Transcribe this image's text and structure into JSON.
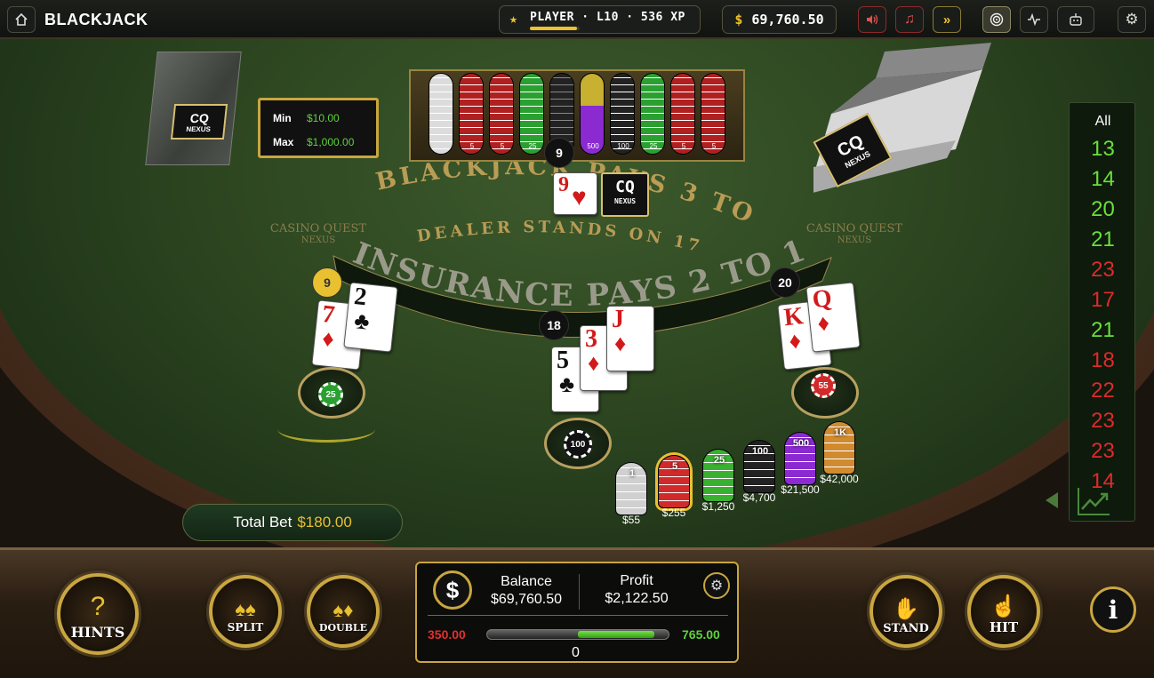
{
  "topbar": {
    "title": "BLACKJACK",
    "player_label": "PLAYER · L10 · 536 XP",
    "xp_progress": 0.95,
    "currency_symbol": "$",
    "balance_display": "69,760.50",
    "icons": [
      "home-icon",
      "volume-icon",
      "music-icon",
      "fast-forward-icon",
      "target-icon",
      "activity-icon",
      "robot-icon",
      "settings-icon"
    ]
  },
  "table": {
    "min_label": "Min",
    "min_value": "$10.00",
    "max_label": "Max",
    "max_value": "$1,000.00",
    "felt_line1": "BLACKJACK PAYS 3 TO 2",
    "felt_line2": "DEALER STANDS ON 17",
    "felt_line3": "INSURANCE PAYS 2 TO 1",
    "brand_logo": "CASINO QUEST",
    "brand_sub": "NEXUS",
    "shoe_logo": "CQ",
    "shoe_logo_sub": "NEXUS",
    "tray_chip_labels": [
      "5",
      "5",
      "25",
      "",
      "500",
      "100",
      "25",
      "5",
      "5"
    ],
    "dealer": {
      "score": "9",
      "cards": [
        {
          "rank": "9",
          "suit": "♥",
          "color": "red"
        }
      ],
      "hole_card_logo": "CQ",
      "hole_card_sub": "NEXUS"
    },
    "hands": [
      {
        "score": "9",
        "active": true,
        "cards": [
          {
            "rank": "7",
            "suit": "♦",
            "color": "red"
          },
          {
            "rank": "2",
            "suit": "♣",
            "color": "black"
          }
        ],
        "bet_chip": "25"
      },
      {
        "score": "18",
        "active": false,
        "cards": [
          {
            "rank": "5",
            "suit": "♣",
            "color": "black"
          },
          {
            "rank": "3",
            "suit": "♦",
            "color": "red"
          },
          {
            "rank": "J",
            "suit": "♦",
            "color": "red"
          }
        ],
        "bet_chip": "100"
      },
      {
        "score": "20",
        "active": false,
        "cards": [
          {
            "rank": "K",
            "suit": "♦",
            "color": "red"
          },
          {
            "rank": "Q",
            "suit": "♦",
            "color": "red"
          }
        ],
        "bet_chip": "55"
      }
    ],
    "chip_stacks": [
      {
        "label": "1",
        "amount": "$55",
        "color": "#d0d0d0"
      },
      {
        "label": "5",
        "amount": "$255",
        "color": "#d02a2a"
      },
      {
        "label": "25",
        "amount": "$1,250",
        "color": "#3ab030"
      },
      {
        "label": "100",
        "amount": "$4,700",
        "color": "#222222"
      },
      {
        "label": "500",
        "amount": "$21,500",
        "color": "#8a2ad0"
      },
      {
        "label": "1K",
        "amount": "$42,000",
        "color": "#d08a30"
      }
    ],
    "total_bet_label": "Total Bet",
    "total_bet_amount": "$180.00"
  },
  "history": {
    "filter": "All",
    "results": [
      {
        "value": "13",
        "color": "green"
      },
      {
        "value": "14",
        "color": "green"
      },
      {
        "value": "20",
        "color": "green"
      },
      {
        "value": "21",
        "color": "green"
      },
      {
        "value": "23",
        "color": "red"
      },
      {
        "value": "17",
        "color": "red"
      },
      {
        "value": "21",
        "color": "green"
      },
      {
        "value": "18",
        "color": "red"
      },
      {
        "value": "22",
        "color": "red"
      },
      {
        "value": "23",
        "color": "red"
      },
      {
        "value": "23",
        "color": "red"
      },
      {
        "value": "14",
        "color": "red"
      }
    ]
  },
  "controls": {
    "hints": "HINTS",
    "split": "SPLIT",
    "double": "DOUBLE",
    "stand": "STAND",
    "hit": "HIT",
    "info": "i"
  },
  "stats": {
    "balance_label": "Balance",
    "balance_value": "$69,760.50",
    "profit_label": "Profit",
    "profit_value": "$2,122.50",
    "low_value": "350.00",
    "high_value": "765.00",
    "center_value": "0",
    "bar_start_fraction": 0.5,
    "bar_end_fraction": 0.92
  }
}
